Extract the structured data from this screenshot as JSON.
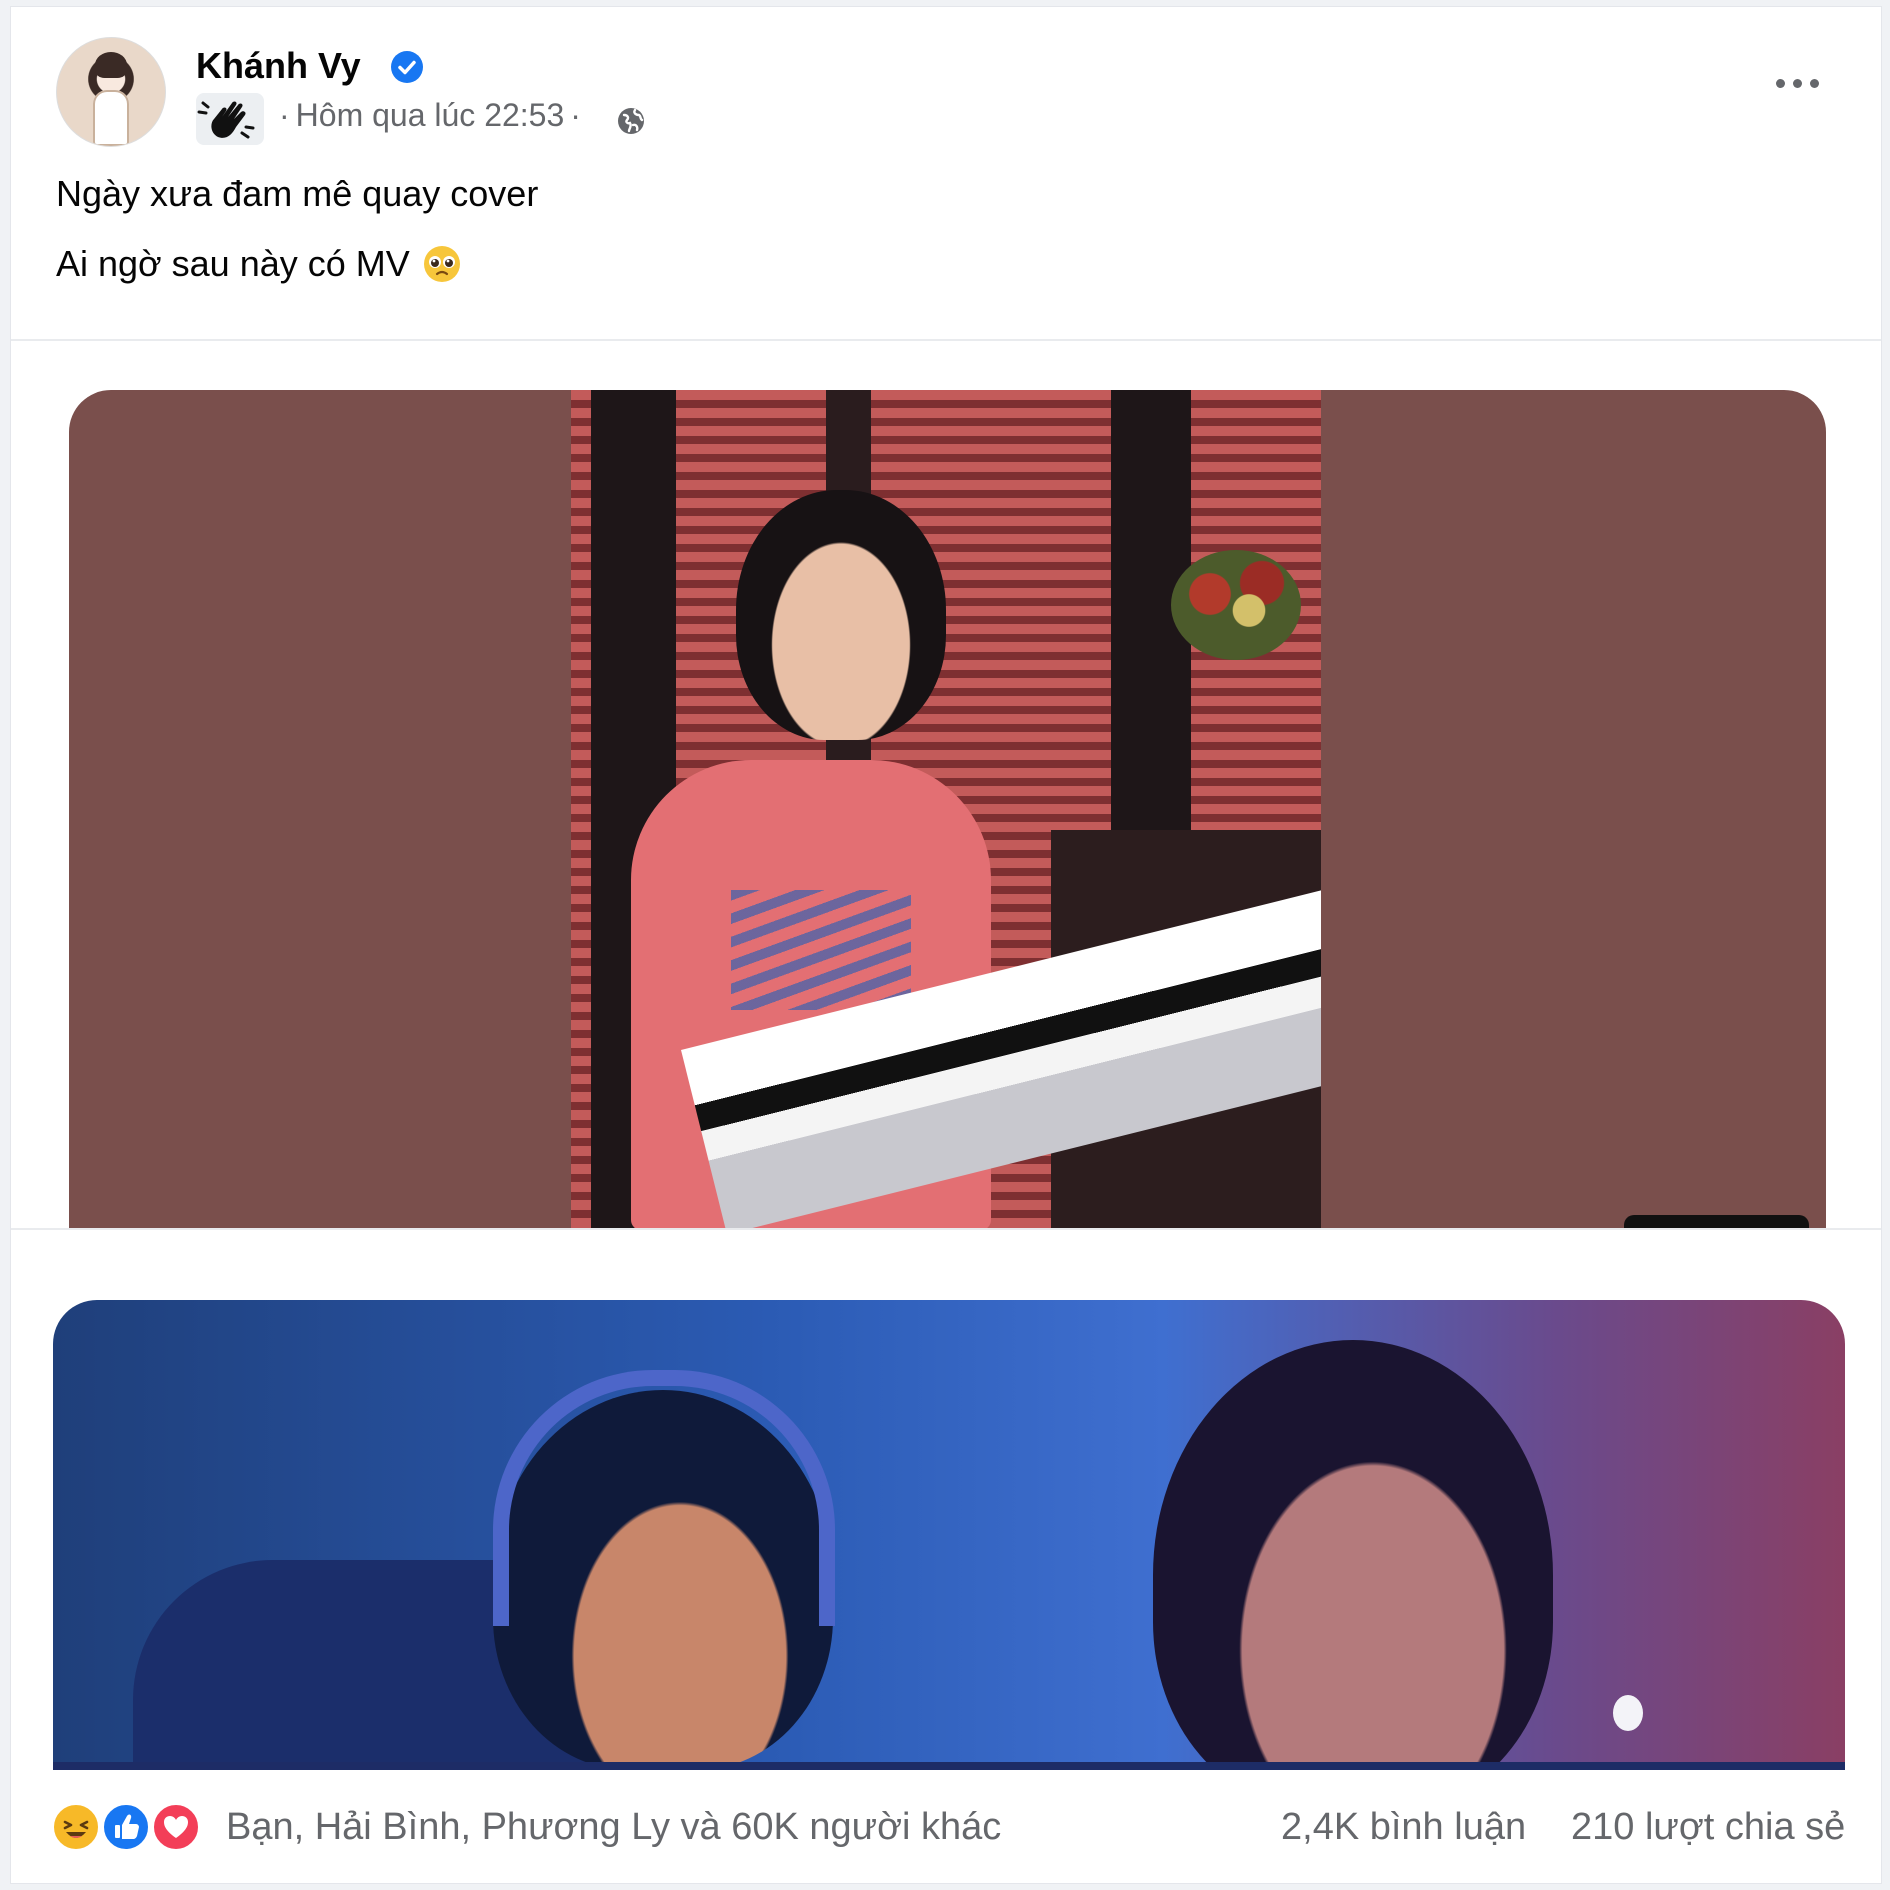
{
  "post": {
    "author": "Khánh Vy",
    "timestamp": "Hôm qua lúc 22:53",
    "separator": "·",
    "audience_icon": "globe-icon",
    "verified_icon": "verified-badge-icon",
    "sticker_icon": "waving-hand-sticker-icon",
    "text_lines": [
      "Ngày xưa đam mê quay cover",
      "Ai ngờ sau này có MV"
    ],
    "text_emoji": "pleading-face-emoji-icon"
  },
  "footer": {
    "reactions": [
      "haha-icon",
      "like-icon",
      "love-icon"
    ],
    "reactors_text": "Bạn, Hải Bình, Phương Ly và 60K người khác",
    "comments_text": "2,4K bình luận",
    "shares_text": "210 lượt chia sẻ"
  },
  "colors": {
    "brand_blue": "#1877f2",
    "secondary_text": "#65676b",
    "love_red": "#f33e58",
    "haha_yellow": "#f7b928"
  }
}
